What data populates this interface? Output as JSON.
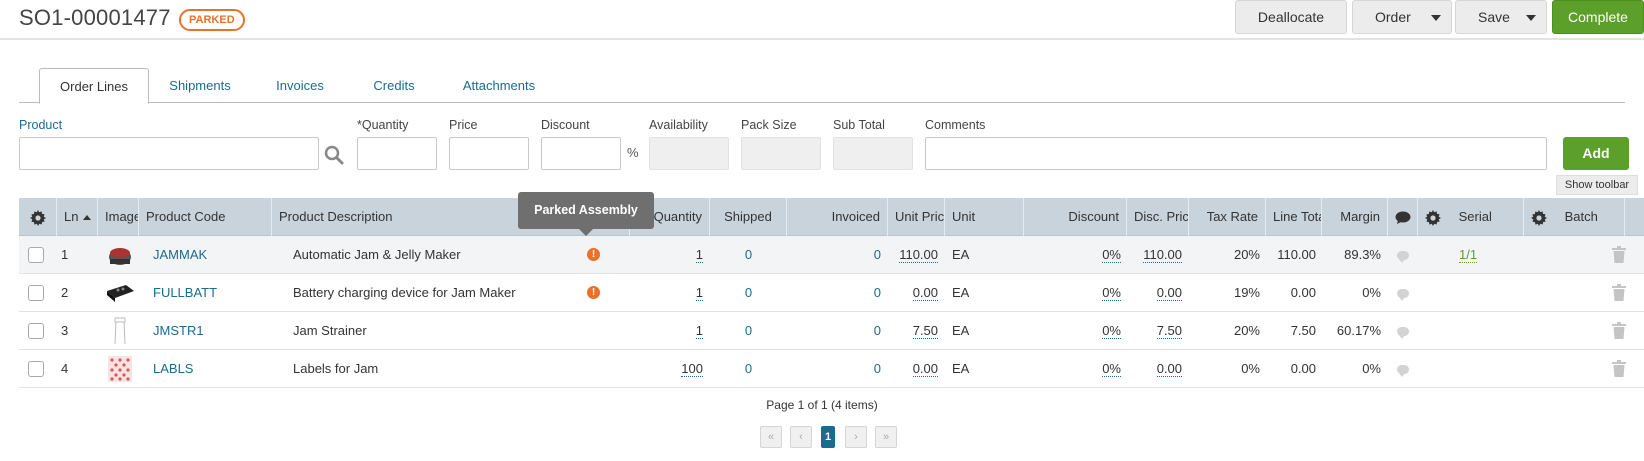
{
  "header": {
    "order_number": "SO1-00001477",
    "status": "PARKED",
    "buttons": {
      "deallocate": "Deallocate",
      "order": "Order",
      "save": "Save",
      "complete": "Complete"
    }
  },
  "tabs": [
    {
      "label": "Order Lines",
      "active": true
    },
    {
      "label": "Shipments",
      "active": false
    },
    {
      "label": "Invoices",
      "active": false
    },
    {
      "label": "Credits",
      "active": false
    },
    {
      "label": "Attachments",
      "active": false
    }
  ],
  "form": {
    "product_label": "Product",
    "quantity_label": "*Quantity",
    "price_label": "Price",
    "discount_label": "Discount",
    "percent_symbol": "%",
    "availability_label": "Availability",
    "pack_size_label": "Pack Size",
    "sub_total_label": "Sub Total",
    "comments_label": "Comments",
    "product_value": "",
    "quantity_value": "",
    "price_value": "",
    "discount_value": "",
    "comments_value": "",
    "add_button": "Add",
    "show_toolbar": "Show toolbar"
  },
  "grid": {
    "columns": {
      "ln": "Ln",
      "image": "Image",
      "product_code": "Product Code",
      "product_description": "Product Description",
      "quantity": "Quantity",
      "shipped": "Shipped",
      "invoiced": "Invoiced",
      "unit_price": "Unit Price",
      "unit": "Unit",
      "discount": "Discount",
      "disc_price": "Disc. Price",
      "tax_rate": "Tax Rate",
      "line_total": "Line Total",
      "margin": "Margin",
      "serial": "Serial",
      "batch": "Batch"
    },
    "rows": [
      {
        "ln": "1",
        "code": "JAMMAK",
        "description": "Automatic Jam & Jelly Maker",
        "quantity": "1",
        "shipped": "0",
        "invoiced": "0",
        "unit_price": "110.00",
        "unit": "EA",
        "discount": "0%",
        "disc_price": "110.00",
        "tax_rate": "20%",
        "line_total": "110.00",
        "margin": "89.3%",
        "serial": "1/1",
        "parked_assembly": true
      },
      {
        "ln": "2",
        "code": "FULLBATT",
        "description": "Battery charging device for Jam Maker",
        "quantity": "1",
        "shipped": "0",
        "invoiced": "0",
        "unit_price": "0.00",
        "unit": "EA",
        "discount": "0%",
        "disc_price": "0.00",
        "tax_rate": "19%",
        "line_total": "0.00",
        "margin": "0%",
        "serial": "",
        "parked_assembly": true
      },
      {
        "ln": "3",
        "code": "JMSTR1",
        "description": "Jam Strainer",
        "quantity": "1",
        "shipped": "0",
        "invoiced": "0",
        "unit_price": "7.50",
        "unit": "EA",
        "discount": "0%",
        "disc_price": "7.50",
        "tax_rate": "20%",
        "line_total": "7.50",
        "margin": "60.17%",
        "serial": "",
        "parked_assembly": false
      },
      {
        "ln": "4",
        "code": "LABLS",
        "description": "Labels for Jam",
        "quantity": "100",
        "shipped": "0",
        "invoiced": "0",
        "unit_price": "0.00",
        "unit": "EA",
        "discount": "0%",
        "disc_price": "0.00",
        "tax_rate": "0%",
        "line_total": "0.00",
        "margin": "0%",
        "serial": "",
        "parked_assembly": false
      }
    ]
  },
  "tooltip": "Parked Assembly",
  "pager": {
    "summary": "Page 1 of 1 (4 items)",
    "current_page": "1",
    "first": "«",
    "prev": "‹",
    "next": "›",
    "last": "»"
  },
  "colors": {
    "accent_green": "#5c9f2a",
    "link_blue": "#1a6b8f",
    "parked_orange": "#e8722a",
    "grid_header": "#c9d3dc"
  }
}
